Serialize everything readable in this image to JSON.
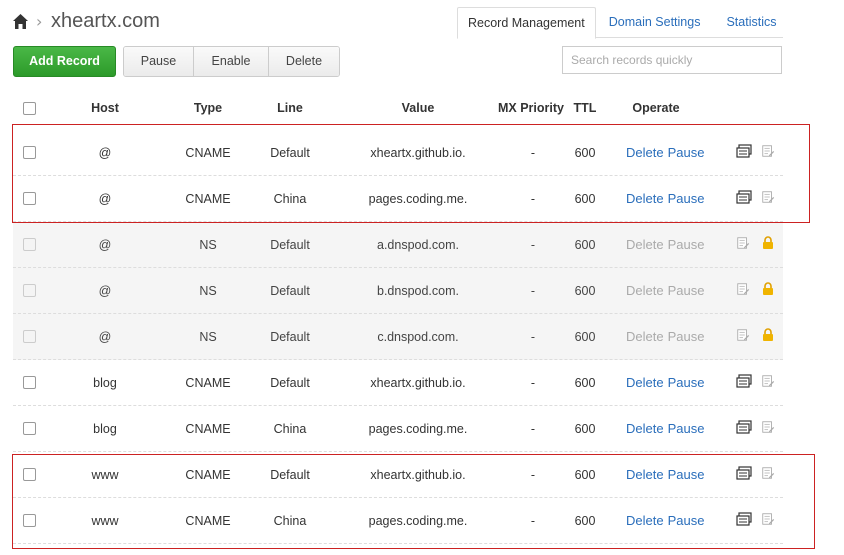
{
  "header": {
    "domain": "xheartx.com",
    "crumb_sep": "›",
    "tabs": [
      {
        "label": "Record Management"
      },
      {
        "label": "Domain Settings"
      },
      {
        "label": "Statistics"
      }
    ]
  },
  "toolbar": {
    "add_label": "Add Record",
    "pause_label": "Pause",
    "enable_label": "Enable",
    "delete_label": "Delete",
    "search_placeholder": "Search records quickly"
  },
  "columns": {
    "host": "Host",
    "type": "Type",
    "line": "Line",
    "value": "Value",
    "mx": "MX Priority",
    "ttl": "TTL",
    "operate": "Operate"
  },
  "records": [
    {
      "host": "@",
      "type": "CNAME",
      "line": "Default",
      "value": "xheartx.github.io.",
      "mx": "-",
      "ttl": "600",
      "del": "Delete",
      "pause": "Pause",
      "locked": false
    },
    {
      "host": "@",
      "type": "CNAME",
      "line": "China",
      "value": "pages.coding.me.",
      "mx": "-",
      "ttl": "600",
      "del": "Delete",
      "pause": "Pause",
      "locked": false
    },
    {
      "host": "@",
      "type": "NS",
      "line": "Default",
      "value": "a.dnspod.com.",
      "mx": "-",
      "ttl": "600",
      "del": "Delete",
      "pause": "Pause",
      "locked": true
    },
    {
      "host": "@",
      "type": "NS",
      "line": "Default",
      "value": "b.dnspod.com.",
      "mx": "-",
      "ttl": "600",
      "del": "Delete",
      "pause": "Pause",
      "locked": true
    },
    {
      "host": "@",
      "type": "NS",
      "line": "Default",
      "value": "c.dnspod.com.",
      "mx": "-",
      "ttl": "600",
      "del": "Delete",
      "pause": "Pause",
      "locked": true
    },
    {
      "host": "blog",
      "type": "CNAME",
      "line": "Default",
      "value": "xheartx.github.io.",
      "mx": "-",
      "ttl": "600",
      "del": "Delete",
      "pause": "Pause",
      "locked": false
    },
    {
      "host": "blog",
      "type": "CNAME",
      "line": "China",
      "value": "pages.coding.me.",
      "mx": "-",
      "ttl": "600",
      "del": "Delete",
      "pause": "Pause",
      "locked": false
    },
    {
      "host": "www",
      "type": "CNAME",
      "line": "Default",
      "value": "xheartx.github.io.",
      "mx": "-",
      "ttl": "600",
      "del": "Delete",
      "pause": "Pause",
      "locked": false
    },
    {
      "host": "www",
      "type": "CNAME",
      "line": "China",
      "value": "pages.coding.me.",
      "mx": "-",
      "ttl": "600",
      "del": "Delete",
      "pause": "Pause",
      "locked": false
    }
  ],
  "colors": {
    "accent_green": "#2c9a2a",
    "link_blue": "#2a6ebb",
    "highlight_red": "#cc2222",
    "lock_yellow": "#f0b400"
  },
  "icons": {
    "home": "home-icon",
    "remark": "remark-icon",
    "edit": "edit-note-icon",
    "lock": "lock-icon"
  }
}
